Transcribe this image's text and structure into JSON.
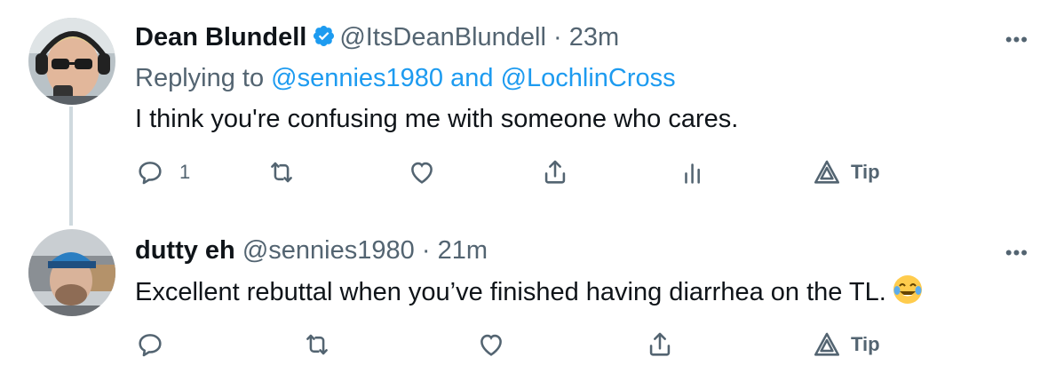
{
  "tweets": [
    {
      "name": "Dean Blundell",
      "verified": true,
      "handle": "@ItsDeanBlundell",
      "dot": "·",
      "time": "23m",
      "replying_prefix": "Replying to",
      "replying_user1": "@sennies1980",
      "replying_and": "and",
      "replying_user2": "@LochlinCross",
      "text": "I think you're confusing me with someone who cares.",
      "reply_count": "1",
      "tip_label": "Tip",
      "more": "•••"
    },
    {
      "name": "dutty eh",
      "verified": false,
      "handle": "@sennies1980",
      "dot": "·",
      "time": "21m",
      "text": "Excellent rebuttal when you’ve finished having diarrhea on the TL.",
      "tip_label": "Tip",
      "more": "•••"
    }
  ],
  "colors": {
    "accent": "#1d9bf0",
    "secondary_text": "#536471",
    "thread_line": "#cfd9de"
  }
}
